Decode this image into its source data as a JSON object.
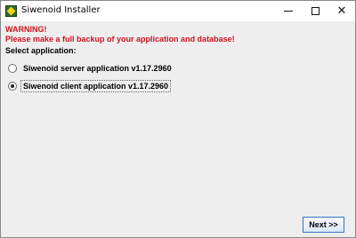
{
  "window": {
    "title": "Siwenoid Installer",
    "icon": "siwenoid-app-icon"
  },
  "caption_buttons": {
    "minimize_icon": "minimize-icon",
    "maximize_icon": "maximize-icon",
    "close_icon": "close-icon",
    "close_glyph": "✕"
  },
  "warning": {
    "line1": "WARNING!",
    "line2": "Please make a full backup of your application and database!",
    "color": "#c8141e"
  },
  "select": {
    "label": "Select application:",
    "options": [
      {
        "label": "Siwenoid server application v1.17.2960",
        "selected": false
      },
      {
        "label": "Siwenoid client application v1.17.2960",
        "selected": true
      }
    ]
  },
  "footer": {
    "next_label": "Next >>"
  }
}
